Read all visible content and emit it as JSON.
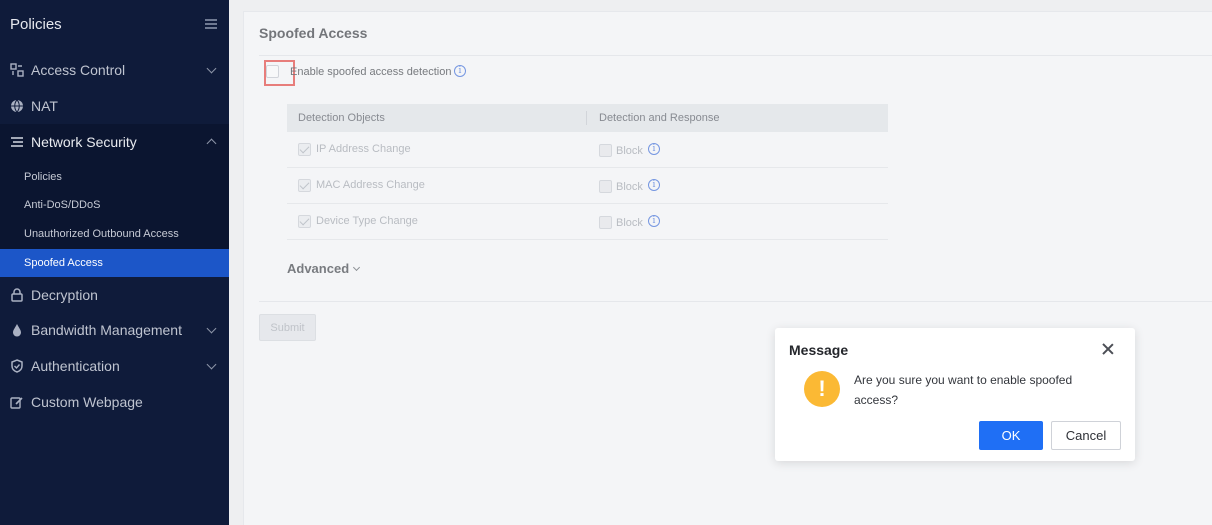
{
  "sidebar": {
    "title": "Policies",
    "items": [
      {
        "label": "Access Control",
        "icon": "access-control-icon",
        "chevron": "down"
      },
      {
        "label": "NAT",
        "icon": "globe-icon"
      },
      {
        "label": "Network Security",
        "icon": "list-icon",
        "chevron": "up",
        "expanded": true
      },
      {
        "label": "Decryption",
        "icon": "lock-icon"
      },
      {
        "label": "Bandwidth Management",
        "icon": "drop-icon",
        "chevron": "down"
      },
      {
        "label": "Authentication",
        "icon": "shield-check-icon",
        "chevron": "down"
      },
      {
        "label": "Custom Webpage",
        "icon": "edit-page-icon"
      }
    ],
    "subitems": [
      {
        "label": "Policies"
      },
      {
        "label": "Anti-DoS/DDoS"
      },
      {
        "label": "Unauthorized Outbound Access"
      },
      {
        "label": "Spoofed Access",
        "active": true
      }
    ]
  },
  "main": {
    "title": "Spoofed Access",
    "enable_label": "Enable spoofed access detection",
    "table": {
      "headers": [
        "Detection Objects",
        "Detection and Response"
      ],
      "rows": [
        {
          "object": "IP Address Change",
          "response": "Block"
        },
        {
          "object": "MAC Address Change",
          "response": "Block"
        },
        {
          "object": "Device Type Change",
          "response": "Block"
        }
      ]
    },
    "advanced_label": "Advanced",
    "submit_label": "Submit"
  },
  "dialog": {
    "title": "Message",
    "message": "Are you sure you want to enable spoofed access?",
    "ok_label": "OK",
    "cancel_label": "Cancel"
  },
  "colors": {
    "sidebar_bg": "#0f1b3a",
    "active_item": "#1c56c8",
    "primary_button": "#1f6ff5",
    "warning": "#fbb934",
    "highlight": "#e53935"
  }
}
